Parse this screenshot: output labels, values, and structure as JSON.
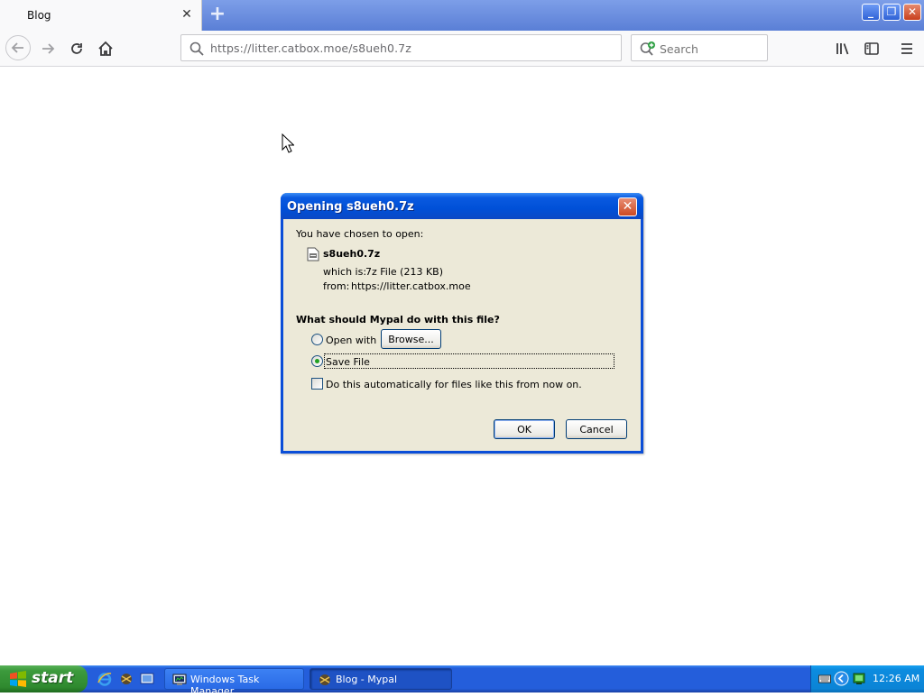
{
  "browser": {
    "tab_title": "Blog",
    "url": "https://litter.catbox.moe/s8ueh0.7z",
    "search_placeholder": "Search"
  },
  "dialog": {
    "title": "Opening s8ueh0.7z",
    "chosen_label": "You have chosen to open:",
    "file_name": "s8ueh0.7z",
    "which_label": "which is:",
    "which_value": "7z File (213 KB)",
    "from_label": "from:",
    "from_value": "https://litter.catbox.moe",
    "question": "What should Mypal do with this file?",
    "open_with_label": "Open with",
    "browse_label": "Browse...",
    "save_file_label": "Save File",
    "auto_label": "Do this automatically for files like this from now on.",
    "ok_label": "OK",
    "cancel_label": "Cancel",
    "selected_option": "save-file",
    "auto_checked": false
  },
  "taskbar": {
    "start_label": "start",
    "tasks": [
      {
        "label": "Windows Task Manager",
        "active": false
      },
      {
        "label": "Blog - Mypal",
        "active": true
      }
    ],
    "clock": "12:26 AM"
  },
  "colors": {
    "xp_blue": "#0050d8",
    "dialog_bg": "#ece9d8",
    "start_green": "#3c9a3c",
    "tray_blue": "#0b84d6"
  },
  "icons": {
    "tab_close": "close-icon",
    "new_tab": "plus-icon",
    "back": "arrow-left-icon",
    "forward": "arrow-right-icon",
    "reload": "reload-icon",
    "home": "home-icon",
    "url_search": "magnifier-icon",
    "search_engine": "search-add-icon",
    "library": "library-icon",
    "sidebar": "sidebar-icon",
    "menu": "hamburger-menu-icon",
    "file": "archive-file-icon"
  }
}
